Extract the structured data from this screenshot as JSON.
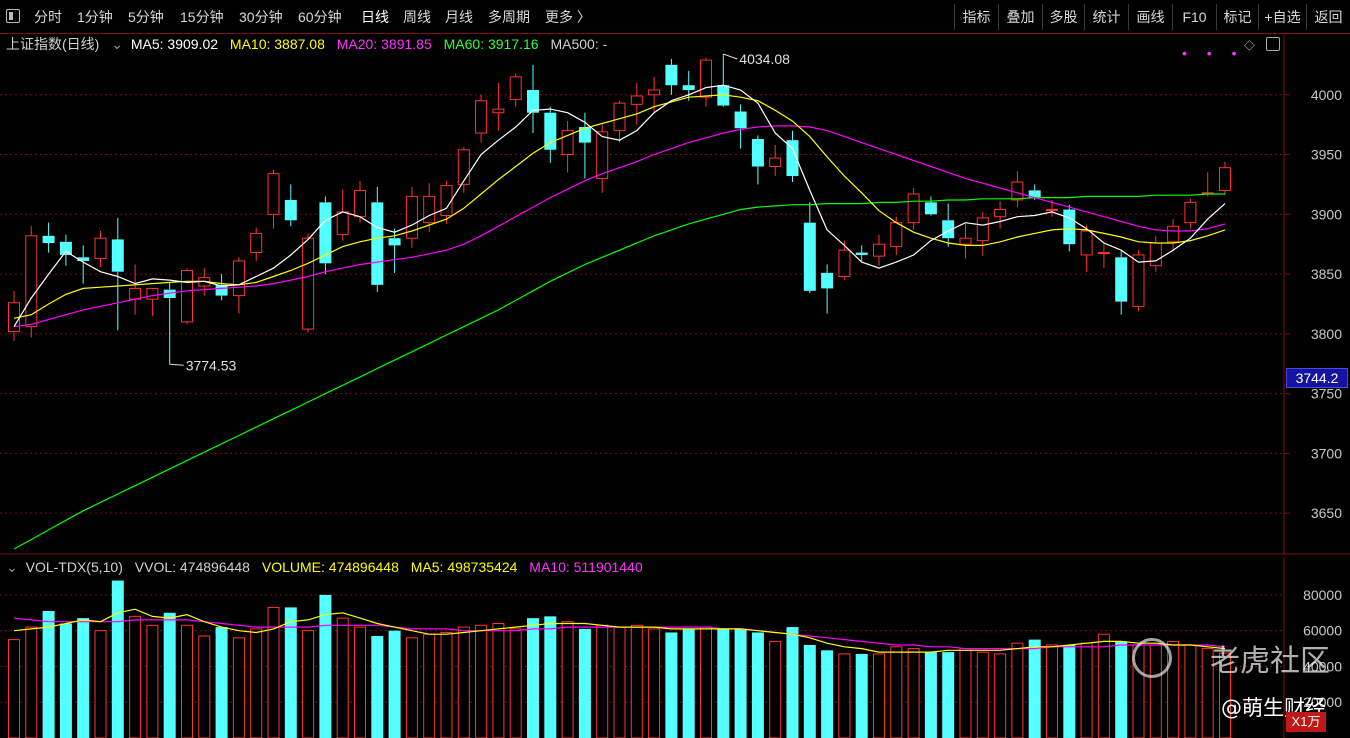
{
  "toolbar": {
    "periods": [
      "分时",
      "1分钟",
      "5分钟",
      "15分钟",
      "30分钟",
      "60分钟",
      "日线",
      "周线",
      "月线",
      "多周期",
      "更多 〉"
    ],
    "active_period": "日线",
    "right_buttons": [
      "指标",
      "叠加",
      "多股",
      "统计",
      "画线",
      "F10",
      "标记",
      "+自选",
      "返回"
    ]
  },
  "main_legend": {
    "title": "上证指数(日线)",
    "ma5": "MA5: 3909.02",
    "ma10": "MA10: 3887.08",
    "ma20": "MA20: 3891.85",
    "ma60": "MA60: 3917.16",
    "ma500": "MA500: -"
  },
  "vol_legend": {
    "title": "VOL-TDX(5,10)",
    "vvol": "VVOL: 474896448",
    "volume": "VOLUME: 474896448",
    "ma5": "MA5: 498735424",
    "ma10": "MA10: 511901440"
  },
  "annotations": {
    "high": "4034.08",
    "low": "3774.53"
  },
  "price_flag": "3744.2",
  "volume_unit": "X1万",
  "watermark": "老虎社区",
  "author": "@萌生财经",
  "colors": {
    "up": "#ff3232",
    "down": "#54ffff",
    "ma5": "#ffffff",
    "ma10": "#ffff00",
    "ma20": "#ff00ff",
    "ma60": "#00ff00",
    "grid": "#7a1010"
  },
  "chart_data": [
    {
      "type": "candlestick",
      "title": "上证指数(日线)",
      "ylim": [
        3615,
        4050
      ],
      "yticks": [
        3650,
        3700,
        3750,
        3800,
        3850,
        3900,
        3950,
        4000
      ],
      "candles": [
        {
          "o": 3802,
          "h": 3836,
          "l": 3794,
          "c": 3826
        },
        {
          "o": 3806,
          "h": 3890,
          "l": 3797,
          "c": 3882
        },
        {
          "o": 3882,
          "h": 3893,
          "l": 3868,
          "c": 3876
        },
        {
          "o": 3877,
          "h": 3883,
          "l": 3857,
          "c": 3866
        },
        {
          "o": 3864,
          "h": 3874,
          "l": 3842,
          "c": 3861
        },
        {
          "o": 3863,
          "h": 3886,
          "l": 3856,
          "c": 3880
        },
        {
          "o": 3879,
          "h": 3897,
          "l": 3803,
          "c": 3852
        },
        {
          "o": 3829,
          "h": 3858,
          "l": 3816,
          "c": 3838
        },
        {
          "o": 3829,
          "h": 3838,
          "l": 3815,
          "c": 3838
        },
        {
          "o": 3837,
          "h": 3843,
          "l": 3774.53,
          "c": 3830
        },
        {
          "o": 3810,
          "h": 3855,
          "l": 3808,
          "c": 3853
        },
        {
          "o": 3840,
          "h": 3855,
          "l": 3832,
          "c": 3847
        },
        {
          "o": 3841,
          "h": 3850,
          "l": 3828,
          "c": 3832
        },
        {
          "o": 3832,
          "h": 3864,
          "l": 3817,
          "c": 3861
        },
        {
          "o": 3868,
          "h": 3889,
          "l": 3861,
          "c": 3884
        },
        {
          "o": 3900,
          "h": 3937,
          "l": 3888,
          "c": 3934
        },
        {
          "o": 3912,
          "h": 3925,
          "l": 3890,
          "c": 3895
        },
        {
          "o": 3804,
          "h": 3884,
          "l": 3801,
          "c": 3880
        },
        {
          "o": 3910,
          "h": 3915,
          "l": 3850,
          "c": 3859
        },
        {
          "o": 3883,
          "h": 3921,
          "l": 3878,
          "c": 3902
        },
        {
          "o": 3898,
          "h": 3928,
          "l": 3893,
          "c": 3920
        },
        {
          "o": 3910,
          "h": 3923,
          "l": 3835,
          "c": 3841
        },
        {
          "o": 3880,
          "h": 3888,
          "l": 3851,
          "c": 3874
        },
        {
          "o": 3880,
          "h": 3923,
          "l": 3872,
          "c": 3915
        },
        {
          "o": 3893,
          "h": 3926,
          "l": 3885,
          "c": 3915
        },
        {
          "o": 3899,
          "h": 3928,
          "l": 3892,
          "c": 3924
        },
        {
          "o": 3925,
          "h": 3956,
          "l": 3918,
          "c": 3954
        },
        {
          "o": 3968,
          "h": 4000,
          "l": 3960,
          "c": 3995
        },
        {
          "o": 3985,
          "h": 4010,
          "l": 3970,
          "c": 3988
        },
        {
          "o": 3996,
          "h": 4018,
          "l": 3990,
          "c": 4015
        },
        {
          "o": 4004,
          "h": 4025,
          "l": 3968,
          "c": 3985
        },
        {
          "o": 3985,
          "h": 3990,
          "l": 3943,
          "c": 3954
        },
        {
          "o": 3950,
          "h": 3978,
          "l": 3935,
          "c": 3970
        },
        {
          "o": 3973,
          "h": 3985,
          "l": 3930,
          "c": 3960
        },
        {
          "o": 3930,
          "h": 3975,
          "l": 3918,
          "c": 3969
        },
        {
          "o": 3970,
          "h": 3995,
          "l": 3960,
          "c": 3993
        },
        {
          "o": 3992,
          "h": 4010,
          "l": 3975,
          "c": 3999
        },
        {
          "o": 4000,
          "h": 4015,
          "l": 3985,
          "c": 4004
        },
        {
          "o": 4025,
          "h": 4030,
          "l": 4000,
          "c": 4008
        },
        {
          "o": 4008,
          "h": 4020,
          "l": 3995,
          "c": 4004
        },
        {
          "o": 3998,
          "h": 4031,
          "l": 3990,
          "c": 4029
        },
        {
          "o": 4008,
          "h": 4034.08,
          "l": 3990,
          "c": 3991
        },
        {
          "o": 3986,
          "h": 3992,
          "l": 3955,
          "c": 3972
        },
        {
          "o": 3963,
          "h": 3966,
          "l": 3925,
          "c": 3940
        },
        {
          "o": 3940,
          "h": 3958,
          "l": 3932,
          "c": 3947
        },
        {
          "o": 3962,
          "h": 3970,
          "l": 3927,
          "c": 3932
        },
        {
          "o": 3893,
          "h": 3910,
          "l": 3834,
          "c": 3836
        },
        {
          "o": 3851,
          "h": 3858,
          "l": 3817,
          "c": 3838
        },
        {
          "o": 3848,
          "h": 3878,
          "l": 3845,
          "c": 3870
        },
        {
          "o": 3868,
          "h": 3874,
          "l": 3861,
          "c": 3866
        },
        {
          "o": 3865,
          "h": 3883,
          "l": 3857,
          "c": 3875
        },
        {
          "o": 3873,
          "h": 3898,
          "l": 3866,
          "c": 3893
        },
        {
          "o": 3893,
          "h": 3922,
          "l": 3887,
          "c": 3917
        },
        {
          "o": 3910,
          "h": 3915,
          "l": 3899,
          "c": 3900
        },
        {
          "o": 3895,
          "h": 3909,
          "l": 3873,
          "c": 3880
        },
        {
          "o": 3875,
          "h": 3892,
          "l": 3863,
          "c": 3880
        },
        {
          "o": 3878,
          "h": 3902,
          "l": 3865,
          "c": 3897
        },
        {
          "o": 3898,
          "h": 3911,
          "l": 3888,
          "c": 3904
        },
        {
          "o": 3912,
          "h": 3936,
          "l": 3906,
          "c": 3927
        },
        {
          "o": 3920,
          "h": 3925,
          "l": 3912,
          "c": 3914
        },
        {
          "o": 3904,
          "h": 3912,
          "l": 3898,
          "c": 3904
        },
        {
          "o": 3904,
          "h": 3908,
          "l": 3869,
          "c": 3875
        },
        {
          "o": 3866,
          "h": 3891,
          "l": 3852,
          "c": 3886
        },
        {
          "o": 3868,
          "h": 3876,
          "l": 3855,
          "c": 3868
        },
        {
          "o": 3864,
          "h": 3869,
          "l": 3816,
          "c": 3827
        },
        {
          "o": 3823,
          "h": 3870,
          "l": 3819,
          "c": 3866
        },
        {
          "o": 3857,
          "h": 3882,
          "l": 3852,
          "c": 3876
        },
        {
          "o": 3877,
          "h": 3896,
          "l": 3870,
          "c": 3890
        },
        {
          "o": 3893,
          "h": 3913,
          "l": 3888,
          "c": 3910
        },
        {
          "o": 3918,
          "h": 3935,
          "l": 3915,
          "c": 3918
        },
        {
          "o": 3920,
          "h": 3944,
          "l": 3916,
          "c": 3939
        }
      ],
      "ma5": [
        3806,
        3830,
        3850,
        3869,
        3860,
        3852,
        3848,
        3842,
        3846,
        3845,
        3843,
        3844,
        3840,
        3841,
        3848,
        3855,
        3866,
        3879,
        3895,
        3902,
        3898,
        3889,
        3885,
        3891,
        3899,
        3905,
        3928,
        3950,
        3962,
        3973,
        3987,
        3988,
        3985,
        3977,
        3965,
        3962,
        3970,
        3985,
        3995,
        4000,
        4006,
        4008,
        4004,
        3993,
        3968,
        3955,
        3920,
        3887,
        3874,
        3860,
        3855,
        3860,
        3866,
        3878,
        3886,
        3893,
        3891,
        3894,
        3898,
        3899,
        3902,
        3897,
        3888,
        3876,
        3870,
        3860,
        3861,
        3870,
        3880,
        3896,
        3909
      ],
      "ma10": [
        3813,
        3816,
        3825,
        3833,
        3838,
        3839,
        3840,
        3841,
        3842,
        3843,
        3844,
        3844,
        3842,
        3841,
        3843,
        3848,
        3853,
        3859,
        3866,
        3873,
        3877,
        3880,
        3882,
        3886,
        3891,
        3896,
        3905,
        3917,
        3929,
        3940,
        3951,
        3960,
        3966,
        3972,
        3976,
        3980,
        3984,
        3990,
        3994,
        3998,
        3999,
        4000,
        3998,
        3995,
        3987,
        3978,
        3965,
        3948,
        3932,
        3918,
        3903,
        3893,
        3885,
        3880,
        3876,
        3874,
        3874,
        3877,
        3881,
        3884,
        3887,
        3888,
        3887,
        3884,
        3881,
        3877,
        3876,
        3876,
        3878,
        3882,
        3887
      ],
      "ma20": [
        3806,
        3808,
        3812,
        3816,
        3820,
        3823,
        3826,
        3829,
        3832,
        3834,
        3836,
        3837,
        3838,
        3839,
        3840,
        3842,
        3845,
        3848,
        3852,
        3855,
        3858,
        3860,
        3862,
        3864,
        3867,
        3870,
        3875,
        3882,
        3890,
        3898,
        3906,
        3914,
        3921,
        3928,
        3934,
        3939,
        3944,
        3950,
        3955,
        3960,
        3964,
        3968,
        3971,
        3973,
        3974,
        3974,
        3973,
        3970,
        3965,
        3960,
        3955,
        3950,
        3945,
        3940,
        3935,
        3930,
        3926,
        3922,
        3918,
        3914,
        3910,
        3906,
        3902,
        3898,
        3894,
        3890,
        3887,
        3886,
        3886,
        3888,
        3892
      ],
      "ma60": [
        3620,
        3628,
        3636,
        3644,
        3652,
        3659,
        3666,
        3673,
        3680,
        3687,
        3694,
        3701,
        3708,
        3715,
        3722,
        3729,
        3736,
        3743,
        3750,
        3757,
        3764,
        3771,
        3778,
        3785,
        3792,
        3799,
        3806,
        3813,
        3820,
        3828,
        3836,
        3844,
        3851,
        3858,
        3864,
        3870,
        3876,
        3882,
        3887,
        3892,
        3896,
        3900,
        3904,
        3906,
        3907,
        3908,
        3908,
        3909,
        3909,
        3909,
        3910,
        3910,
        3911,
        3911,
        3912,
        3912,
        3913,
        3913,
        3913,
        3914,
        3914,
        3914,
        3915,
        3915,
        3915,
        3915,
        3916,
        3916,
        3916,
        3917,
        3917
      ]
    },
    {
      "type": "bar",
      "title": "VOL-TDX(5,10)",
      "ylim": [
        0,
        90000
      ],
      "yticks": [
        20000,
        40000,
        60000,
        80000
      ],
      "unit": "X1万",
      "volumes": [
        55000,
        62000,
        71000,
        64000,
        67000,
        60000,
        88000,
        68000,
        63000,
        70000,
        63000,
        57000,
        62000,
        56000,
        61000,
        73000,
        73000,
        60000,
        80000,
        67000,
        62000,
        57000,
        60000,
        56000,
        58000,
        59000,
        62000,
        63000,
        64000,
        61000,
        67000,
        68000,
        65000,
        61000,
        63000,
        62000,
        63000,
        61000,
        59000,
        61000,
        62000,
        61000,
        61000,
        59000,
        54000,
        62000,
        52000,
        49000,
        47000,
        47000,
        47000,
        51000,
        50000,
        48000,
        48000,
        50000,
        48000,
        47000,
        53000,
        55000,
        52000,
        52000,
        53000,
        58000,
        54000,
        52000,
        52000,
        54000,
        52000,
        50000,
        47500
      ],
      "ma5": [
        60000,
        61000,
        62000,
        64000,
        66000,
        65000,
        70000,
        72000,
        68000,
        67000,
        69000,
        65000,
        62000,
        60000,
        59000,
        61000,
        65000,
        66000,
        69000,
        70000,
        67000,
        64000,
        62000,
        60000,
        58000,
        58000,
        59000,
        60000,
        61000,
        62000,
        63000,
        64000,
        64000,
        64000,
        63000,
        62000,
        62000,
        62000,
        61000,
        61000,
        61000,
        61000,
        61000,
        60000,
        59000,
        58000,
        56000,
        53000,
        51000,
        50000,
        48000,
        48000,
        48000,
        48000,
        49000,
        49000,
        49000,
        49000,
        50000,
        51000,
        51000,
        52000,
        53000,
        54000,
        54000,
        53000,
        53000,
        52000,
        52000,
        51000,
        50000
      ],
      "ma10": [
        67000,
        66000,
        65000,
        65000,
        65000,
        65000,
        65000,
        66000,
        66000,
        66000,
        66000,
        65000,
        64000,
        63000,
        62000,
        62000,
        62000,
        62000,
        63000,
        63000,
        63000,
        63000,
        62000,
        61000,
        61000,
        61000,
        60000,
        60000,
        60000,
        60000,
        61000,
        61000,
        62000,
        62000,
        62000,
        62000,
        62000,
        62000,
        62000,
        62000,
        62000,
        61000,
        61000,
        60000,
        59000,
        58000,
        57000,
        56000,
        55000,
        54000,
        53000,
        52000,
        52000,
        51000,
        51000,
        50000,
        50000,
        50000,
        50000,
        50000,
        51000,
        51000,
        51000,
        51000,
        52000,
        52000,
        52000,
        52000,
        52000,
        52000,
        51000
      ]
    }
  ]
}
